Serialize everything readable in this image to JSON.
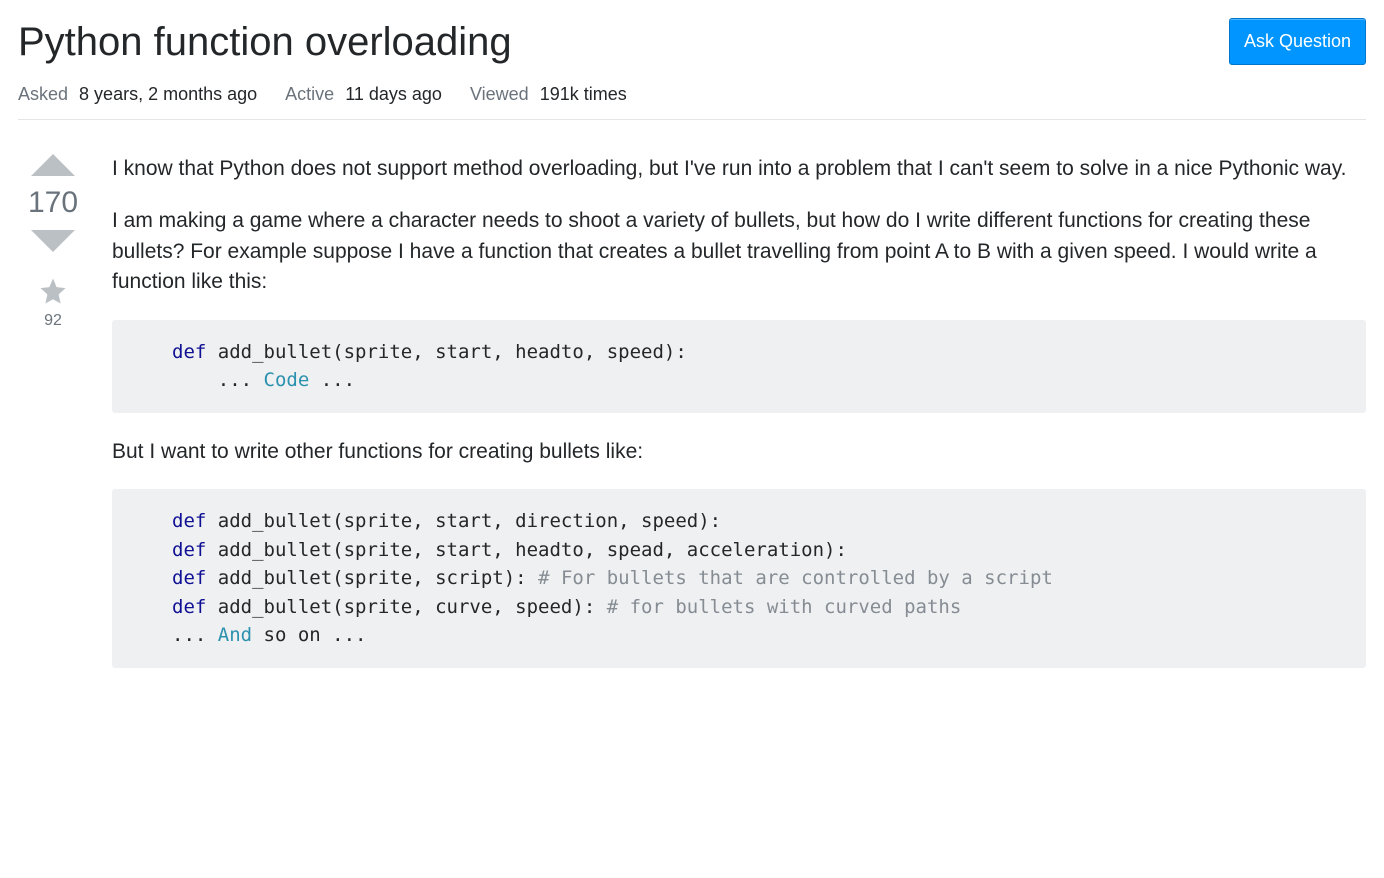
{
  "header": {
    "title": "Python function overloading",
    "ask_button_label": "Ask Question"
  },
  "meta": {
    "asked_label": "Asked",
    "asked_value": "8 years, 2 months ago",
    "active_label": "Active",
    "active_value": "11 days ago",
    "viewed_label": "Viewed",
    "viewed_value": "191k times"
  },
  "votes": {
    "score": "170",
    "favorites": "92"
  },
  "body": {
    "p1": "I know that Python does not support method overloading, but I've run into a problem that I can't seem to solve in a nice Pythonic way.",
    "p2": "I am making a game where a character needs to shoot a variety of bullets, but how do I write different functions for creating these bullets? For example suppose I have a function that creates a bullet travelling from point A to B with a given speed. I would write a function like this:",
    "p3": "But I want to write other functions for creating bullets like:",
    "code1": {
      "def": "def",
      "fn_name": " add_bullet(sprite, start, headto, speed):",
      "ellipsis1": "    ... ",
      "code_word": "Code",
      "ellipsis2": " ..."
    },
    "code2": {
      "def": "def",
      "line1_rest": " add_bullet(sprite, start, direction, speed):",
      "line2_rest": " add_bullet(sprite, start, headto, spead, acceleration):",
      "line3_rest": " add_bullet(sprite, script): ",
      "line3_comment": "# For bullets that are controlled by a script",
      "line4_rest": " add_bullet(sprite, curve, speed): ",
      "line4_comment": "# for bullets with curved paths",
      "tail_pre": "... ",
      "and_word": "And",
      "tail_post": " so on ..."
    }
  }
}
